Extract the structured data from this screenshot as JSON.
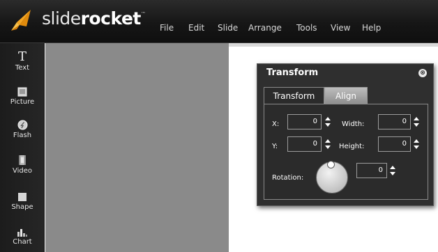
{
  "app": {
    "logo_light": "slide",
    "logo_bold": "rocket",
    "logo_tm": "™"
  },
  "menu": {
    "items": [
      "File",
      "Edit",
      "Slide",
      "Arrange",
      "Tools",
      "View",
      "Help"
    ]
  },
  "toolbar": {
    "items": [
      {
        "label": "Text",
        "icon": "text-icon",
        "glyph": "T"
      },
      {
        "label": "Picture",
        "icon": "picture-icon"
      },
      {
        "label": "Flash",
        "icon": "flash-icon"
      },
      {
        "label": "Video",
        "icon": "video-icon"
      },
      {
        "label": "Shape",
        "icon": "shape-icon"
      },
      {
        "label": "Chart",
        "icon": "chart-icon"
      }
    ]
  },
  "transform_panel": {
    "title": "Transform",
    "close_glyph": "⊗",
    "tabs": [
      {
        "label": "Transform",
        "active": true
      },
      {
        "label": "Align",
        "active": false
      }
    ],
    "fields": {
      "x_label": "X:",
      "x_value": "0",
      "y_label": "Y:",
      "y_value": "0",
      "width_label": "Width:",
      "width_value": "0",
      "height_label": "Height:",
      "height_value": "0",
      "rotation_label": "Rotation:",
      "rotation_value": "0"
    }
  },
  "colors": {
    "topbar": "#161616",
    "toolbar": "#222222",
    "canvas_grey": "#8a8a8a",
    "panel_bg": "#2f2f2f",
    "logo_orange": "#f5a623"
  }
}
